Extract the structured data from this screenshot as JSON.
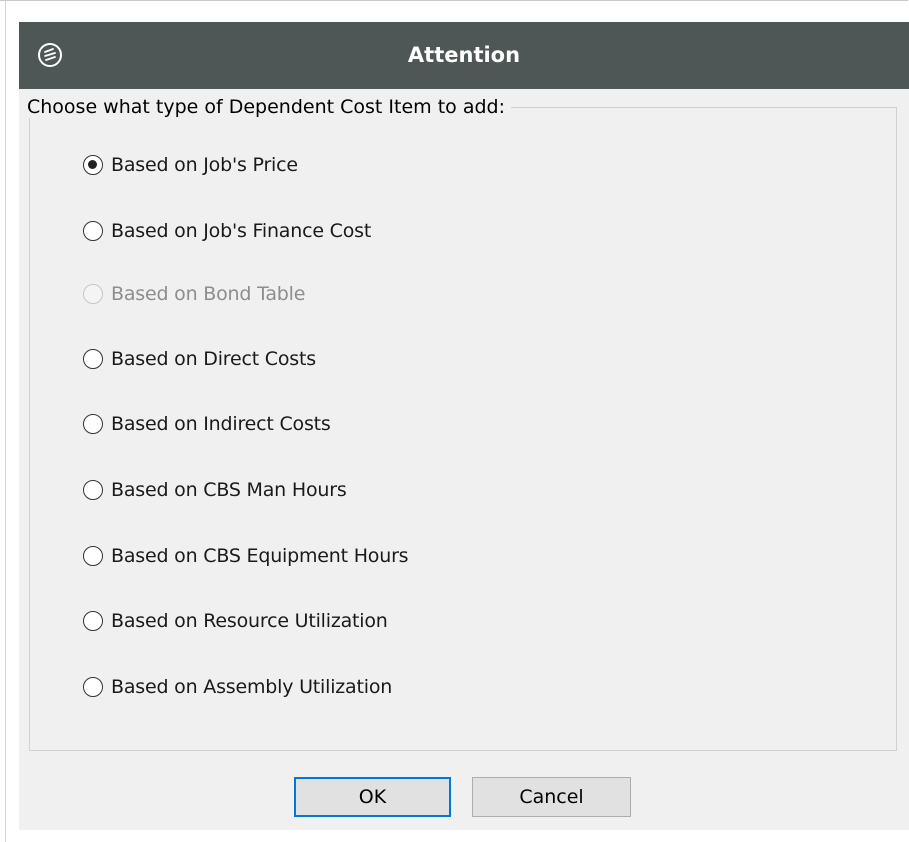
{
  "dialog": {
    "title": "Attention",
    "app_icon": "app-logo-icon"
  },
  "group": {
    "legend": "Choose what type of Dependent Cost Item to add:"
  },
  "options": [
    {
      "label": "Based on Job's Price",
      "checked": true,
      "enabled": true
    },
    {
      "label": "Based on Job's Finance Cost",
      "checked": false,
      "enabled": true
    },
    {
      "label": "Based on Bond Table",
      "checked": false,
      "enabled": false
    },
    {
      "label": "Based on Direct Costs",
      "checked": false,
      "enabled": true
    },
    {
      "label": "Based on Indirect Costs",
      "checked": false,
      "enabled": true
    },
    {
      "label": "Based on CBS Man Hours",
      "checked": false,
      "enabled": true
    },
    {
      "label": "Based on CBS Equipment Hours",
      "checked": false,
      "enabled": true
    },
    {
      "label": "Based on Resource Utilization",
      "checked": false,
      "enabled": true
    },
    {
      "label": "Based on Assembly Utilization",
      "checked": false,
      "enabled": true
    }
  ],
  "buttons": {
    "ok_label": "OK",
    "cancel_label": "Cancel"
  },
  "colors": {
    "titlebar": "#4e5755",
    "dialog_bg": "#f0f0f0",
    "default_button_border": "#0078d7"
  }
}
